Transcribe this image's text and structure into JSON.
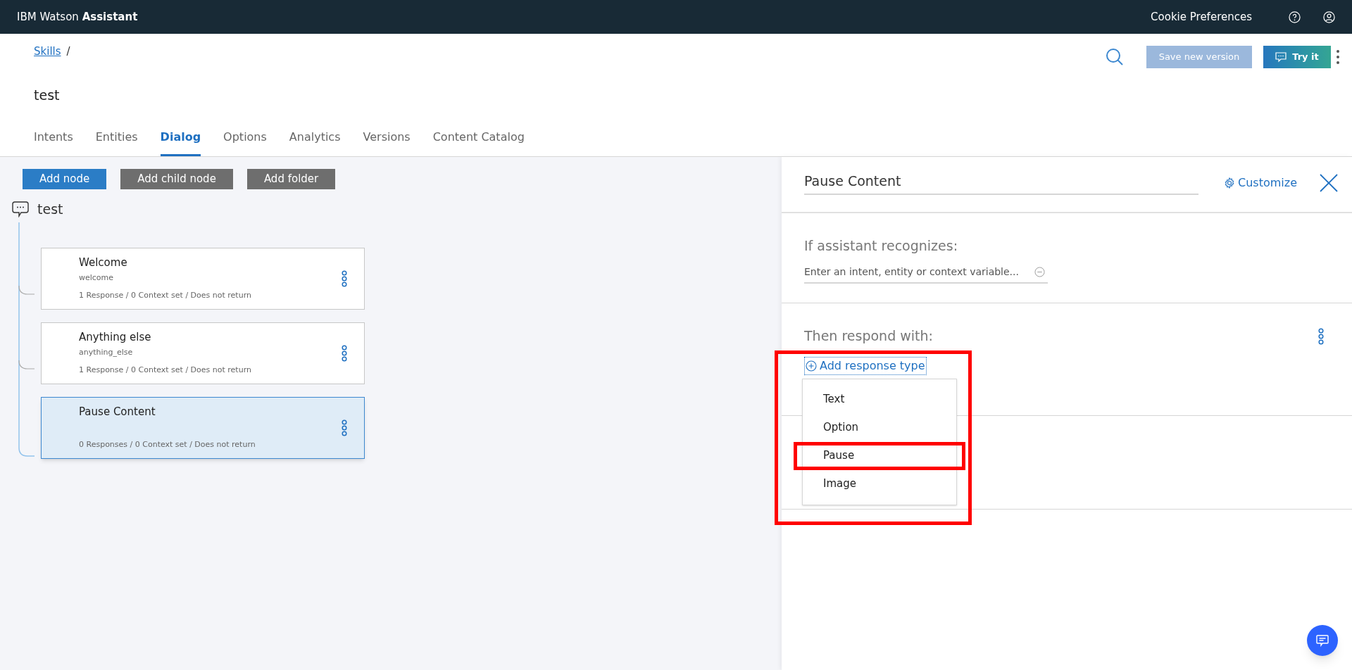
{
  "top_bar": {
    "brand_regular": "IBM Watson ",
    "brand_bold": "Assistant",
    "links": [
      "Cookie Preferences"
    ]
  },
  "breadcrumb": {
    "link": "Skills",
    "separator": "/"
  },
  "skill_title": "test",
  "header_actions": {
    "save": {
      "label": "Save new version",
      "disabled": true
    },
    "try": {
      "label": "Try it"
    }
  },
  "tabs": [
    {
      "label": "Intents",
      "selected": false
    },
    {
      "label": "Entities",
      "selected": false
    },
    {
      "label": "Dialog",
      "selected": true
    },
    {
      "label": "Options",
      "selected": false
    },
    {
      "label": "Analytics",
      "selected": false
    },
    {
      "label": "Versions",
      "selected": false
    },
    {
      "label": "Content Catalog",
      "selected": false
    }
  ],
  "toolbar": [
    {
      "label": "Add node",
      "kind": "primary"
    },
    {
      "label": "Add child node",
      "kind": "secondary"
    },
    {
      "label": "Add folder",
      "kind": "secondary"
    }
  ],
  "tree": {
    "root": "test",
    "nodes": [
      {
        "title": "Welcome",
        "condition": "welcome",
        "summary": "1 Response / 0 Context set / Does not return",
        "selected": false
      },
      {
        "title": "Anything else",
        "condition": "anything_else",
        "summary": "1 Response / 0 Context set / Does not return",
        "selected": false
      },
      {
        "title": "Pause Content",
        "summary": "0 Responses / 0 Context set / Does not return",
        "selected": true
      }
    ]
  },
  "editor": {
    "node_name": "Pause Content",
    "customize": "Customize",
    "condition_label": "If assistant recognizes:",
    "condition_placeholder": "Enter an intent, entity or context variable...",
    "respond_label": "Then respond with:",
    "add_response": "Add response type",
    "menu": {
      "highlighted": true,
      "items": [
        {
          "label": "Text",
          "highlighted": false
        },
        {
          "label": "Option",
          "highlighted": false
        },
        {
          "label": "Pause",
          "highlighted": true
        },
        {
          "label": "Image",
          "highlighted": false
        }
      ]
    }
  }
}
